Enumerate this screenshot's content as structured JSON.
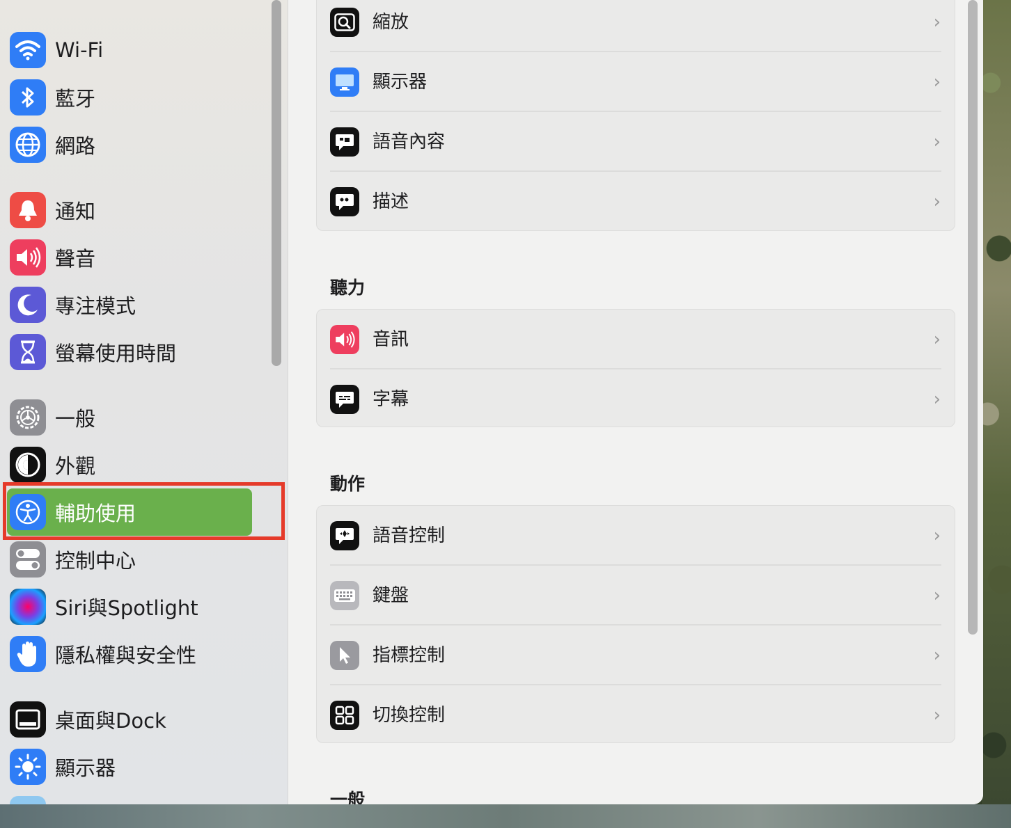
{
  "sidebar": {
    "items": [
      {
        "label": "Wi-Fi"
      },
      {
        "label": "藍牙"
      },
      {
        "label": "網路"
      },
      {
        "label": "通知"
      },
      {
        "label": "聲音"
      },
      {
        "label": "專注模式"
      },
      {
        "label": "螢幕使用時間"
      },
      {
        "label": "一般"
      },
      {
        "label": "外觀"
      },
      {
        "label": "輔助使用",
        "selected": true
      },
      {
        "label": "控制中心"
      },
      {
        "label": "Siri與Spotlight"
      },
      {
        "label": "隱私權與安全性"
      },
      {
        "label": "桌面與Dock"
      },
      {
        "label": "顯示器"
      }
    ]
  },
  "main": {
    "vision_rows": [
      {
        "label": "縮放"
      },
      {
        "label": "顯示器"
      },
      {
        "label": "語音內容"
      },
      {
        "label": "描述"
      }
    ],
    "hearing": {
      "title": "聽力",
      "rows": [
        {
          "label": "音訊"
        },
        {
          "label": "字幕"
        }
      ]
    },
    "motor": {
      "title": "動作",
      "rows": [
        {
          "label": "語音控制"
        },
        {
          "label": "鍵盤"
        },
        {
          "label": "指標控制"
        },
        {
          "label": "切換控制"
        }
      ]
    },
    "general": {
      "title": "一般"
    }
  },
  "colors": {
    "highlight_border": "#e53a2a",
    "selected_bg": "#6ab04c",
    "blue_icon": "#2f7df6"
  }
}
